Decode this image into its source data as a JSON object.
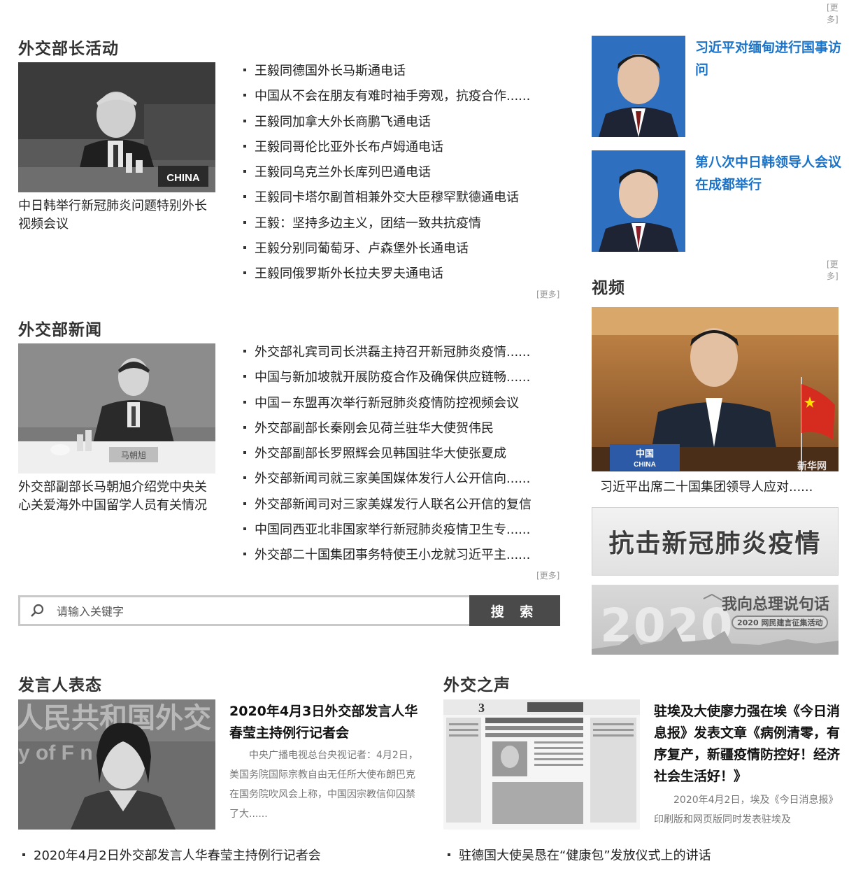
{
  "more_label": "[更多]",
  "minister": {
    "title": "外交部长活动",
    "feature_caption": "中日韩举行新冠肺炎问题特别外长视频会议",
    "items": [
      "王毅同德国外长马斯通电话",
      "中国从不会在朋友有难时袖手旁观，抗疫合作......",
      "王毅同加拿大外长商鹏飞通电话",
      "王毅同哥伦比亚外长布卢姆通电话",
      "王毅同乌克兰外长库列巴通电话",
      "王毅同卡塔尔副首相兼外交大臣穆罕默德通电话",
      "王毅：坚持多边主义，团结一致共抗疫情",
      "王毅分别同葡萄牙、卢森堡外长通电话",
      "王毅同俄罗斯外长拉夫罗夫通电话"
    ],
    "photo_sign": "CHINA"
  },
  "ministry_news": {
    "title": "外交部新闻",
    "feature_caption": "外交部副部长马朝旭介绍党中央关心关爱海外中国留学人员有关情况",
    "items": [
      "外交部礼宾司司长洪磊主持召开新冠肺炎疫情......",
      "中国与新加坡就开展防疫合作及确保供应链畅......",
      "中国－东盟再次举行新冠肺炎疫情防控视频会议",
      "外交部副部长秦刚会见荷兰驻华大使贺伟民",
      "外交部副部长罗照辉会见韩国驻华大使张夏成",
      "外交部新闻司就三家美国媒体发行人公开信向......",
      "外交部新闻司对三家美媒发行人联名公开信的复信",
      "中国同西亚北非国家举行新冠肺炎疫情卫生专......",
      "外交部二十国集团事务特使王小龙就习近平主......"
    ],
    "photo_sign": "马朝旭"
  },
  "search": {
    "placeholder": "请输入关键字",
    "button": "搜 索"
  },
  "leaders": [
    {
      "title": "习近平对缅甸进行国事访问"
    },
    {
      "title": "第八次中日韩领导人会议在成都举行"
    }
  ],
  "video": {
    "title": "视频",
    "caption": "习近平出席二十国集团领导人应对......",
    "photo_sign_line1": "中国",
    "photo_sign_line2": "CHINA",
    "watermark": "新华网"
  },
  "banners": {
    "covid": "抗击新冠肺炎疫情",
    "premier_main": "我向总理说句话",
    "premier_sub": "2020 网民建言征集活动",
    "premier_year": "2020"
  },
  "spokesperson": {
    "title": "发言人表态",
    "headline": "2020年4月3日外交部发言人华春莹主持例行记者会",
    "summary": "中央广播电视总台央视记者：4月2日，美国务院国际宗教自由无任所大使布朗巴克在国务院吹风会上称，中国因宗教信仰囚禁了大......",
    "bottom_item": "2020年4月2日外交部发言人华春莹主持例行记者会",
    "photo_backdrop_line1": "人民共和国外交",
    "photo_backdrop_line2": "y of F    n Af"
  },
  "voice": {
    "title": "外交之声",
    "headline": "驻埃及大使廖力强在埃《今日消息报》发表文章《病例清零，有序复产，新疆疫情防控好！经济社会生活好！》",
    "summary": "2020年4月2日，埃及《今日消息报》印刷版和网页版同时发表驻埃及",
    "bottom_item": "驻德国大使吴恳在“健康包”发放仪式上的讲话",
    "newspaper_page": "3"
  },
  "colors": {
    "link_blue": "#1a73c9",
    "search_button": "#4a4a4a",
    "text": "#222222",
    "muted": "#999999"
  }
}
